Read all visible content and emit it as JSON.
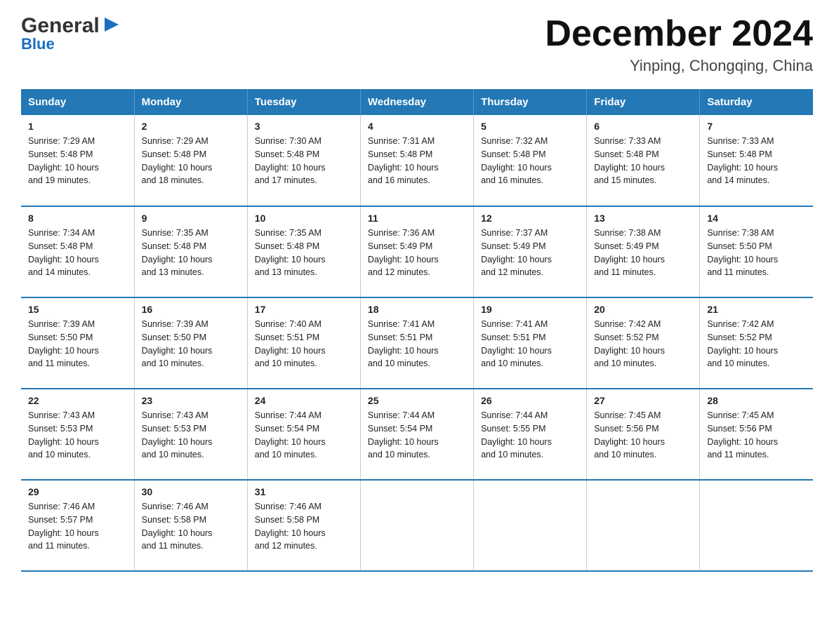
{
  "logo": {
    "general": "General",
    "blue": "Blue",
    "arrow": "▶"
  },
  "title": {
    "month_year": "December 2024",
    "location": "Yinping, Chongqing, China"
  },
  "headers": [
    "Sunday",
    "Monday",
    "Tuesday",
    "Wednesday",
    "Thursday",
    "Friday",
    "Saturday"
  ],
  "weeks": [
    [
      {
        "day": "1",
        "info": "Sunrise: 7:29 AM\nSunset: 5:48 PM\nDaylight: 10 hours\nand 19 minutes."
      },
      {
        "day": "2",
        "info": "Sunrise: 7:29 AM\nSunset: 5:48 PM\nDaylight: 10 hours\nand 18 minutes."
      },
      {
        "day": "3",
        "info": "Sunrise: 7:30 AM\nSunset: 5:48 PM\nDaylight: 10 hours\nand 17 minutes."
      },
      {
        "day": "4",
        "info": "Sunrise: 7:31 AM\nSunset: 5:48 PM\nDaylight: 10 hours\nand 16 minutes."
      },
      {
        "day": "5",
        "info": "Sunrise: 7:32 AM\nSunset: 5:48 PM\nDaylight: 10 hours\nand 16 minutes."
      },
      {
        "day": "6",
        "info": "Sunrise: 7:33 AM\nSunset: 5:48 PM\nDaylight: 10 hours\nand 15 minutes."
      },
      {
        "day": "7",
        "info": "Sunrise: 7:33 AM\nSunset: 5:48 PM\nDaylight: 10 hours\nand 14 minutes."
      }
    ],
    [
      {
        "day": "8",
        "info": "Sunrise: 7:34 AM\nSunset: 5:48 PM\nDaylight: 10 hours\nand 14 minutes."
      },
      {
        "day": "9",
        "info": "Sunrise: 7:35 AM\nSunset: 5:48 PM\nDaylight: 10 hours\nand 13 minutes."
      },
      {
        "day": "10",
        "info": "Sunrise: 7:35 AM\nSunset: 5:48 PM\nDaylight: 10 hours\nand 13 minutes."
      },
      {
        "day": "11",
        "info": "Sunrise: 7:36 AM\nSunset: 5:49 PM\nDaylight: 10 hours\nand 12 minutes."
      },
      {
        "day": "12",
        "info": "Sunrise: 7:37 AM\nSunset: 5:49 PM\nDaylight: 10 hours\nand 12 minutes."
      },
      {
        "day": "13",
        "info": "Sunrise: 7:38 AM\nSunset: 5:49 PM\nDaylight: 10 hours\nand 11 minutes."
      },
      {
        "day": "14",
        "info": "Sunrise: 7:38 AM\nSunset: 5:50 PM\nDaylight: 10 hours\nand 11 minutes."
      }
    ],
    [
      {
        "day": "15",
        "info": "Sunrise: 7:39 AM\nSunset: 5:50 PM\nDaylight: 10 hours\nand 11 minutes."
      },
      {
        "day": "16",
        "info": "Sunrise: 7:39 AM\nSunset: 5:50 PM\nDaylight: 10 hours\nand 10 minutes."
      },
      {
        "day": "17",
        "info": "Sunrise: 7:40 AM\nSunset: 5:51 PM\nDaylight: 10 hours\nand 10 minutes."
      },
      {
        "day": "18",
        "info": "Sunrise: 7:41 AM\nSunset: 5:51 PM\nDaylight: 10 hours\nand 10 minutes."
      },
      {
        "day": "19",
        "info": "Sunrise: 7:41 AM\nSunset: 5:51 PM\nDaylight: 10 hours\nand 10 minutes."
      },
      {
        "day": "20",
        "info": "Sunrise: 7:42 AM\nSunset: 5:52 PM\nDaylight: 10 hours\nand 10 minutes."
      },
      {
        "day": "21",
        "info": "Sunrise: 7:42 AM\nSunset: 5:52 PM\nDaylight: 10 hours\nand 10 minutes."
      }
    ],
    [
      {
        "day": "22",
        "info": "Sunrise: 7:43 AM\nSunset: 5:53 PM\nDaylight: 10 hours\nand 10 minutes."
      },
      {
        "day": "23",
        "info": "Sunrise: 7:43 AM\nSunset: 5:53 PM\nDaylight: 10 hours\nand 10 minutes."
      },
      {
        "day": "24",
        "info": "Sunrise: 7:44 AM\nSunset: 5:54 PM\nDaylight: 10 hours\nand 10 minutes."
      },
      {
        "day": "25",
        "info": "Sunrise: 7:44 AM\nSunset: 5:54 PM\nDaylight: 10 hours\nand 10 minutes."
      },
      {
        "day": "26",
        "info": "Sunrise: 7:44 AM\nSunset: 5:55 PM\nDaylight: 10 hours\nand 10 minutes."
      },
      {
        "day": "27",
        "info": "Sunrise: 7:45 AM\nSunset: 5:56 PM\nDaylight: 10 hours\nand 10 minutes."
      },
      {
        "day": "28",
        "info": "Sunrise: 7:45 AM\nSunset: 5:56 PM\nDaylight: 10 hours\nand 11 minutes."
      }
    ],
    [
      {
        "day": "29",
        "info": "Sunrise: 7:46 AM\nSunset: 5:57 PM\nDaylight: 10 hours\nand 11 minutes."
      },
      {
        "day": "30",
        "info": "Sunrise: 7:46 AM\nSunset: 5:58 PM\nDaylight: 10 hours\nand 11 minutes."
      },
      {
        "day": "31",
        "info": "Sunrise: 7:46 AM\nSunset: 5:58 PM\nDaylight: 10 hours\nand 12 minutes."
      },
      {
        "day": "",
        "info": ""
      },
      {
        "day": "",
        "info": ""
      },
      {
        "day": "",
        "info": ""
      },
      {
        "day": "",
        "info": ""
      }
    ]
  ]
}
